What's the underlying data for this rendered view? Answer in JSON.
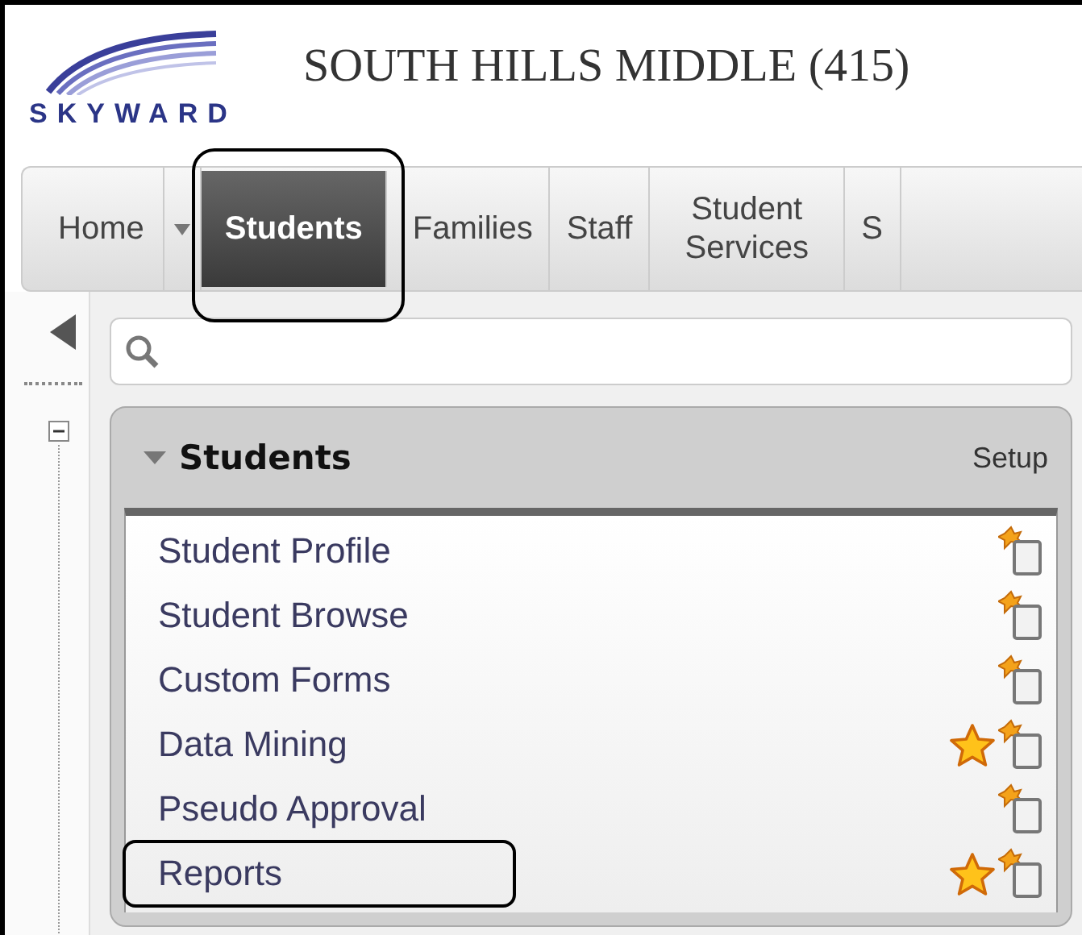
{
  "header": {
    "logo_text": "SKYWARD",
    "title": "SOUTH HILLS MIDDLE (415)"
  },
  "tabs": [
    {
      "label": "Home",
      "selected": false
    },
    {
      "label": "Students",
      "selected": true
    },
    {
      "label": "Families",
      "selected": false
    },
    {
      "label": "Staff",
      "selected": false
    },
    {
      "label": "Student Services",
      "selected": false
    },
    {
      "label": "S",
      "selected": false
    }
  ],
  "panel": {
    "title": "Students",
    "expanded": true,
    "setup": "Setup",
    "items": [
      {
        "label": "Student Profile",
        "favorite": false,
        "highlighted": false
      },
      {
        "label": "Student Browse",
        "favorite": false,
        "highlighted": false
      },
      {
        "label": "Custom Forms",
        "favorite": false,
        "highlighted": false
      },
      {
        "label": "Data Mining",
        "favorite": true,
        "highlighted": false
      },
      {
        "label": "Pseudo Approval",
        "favorite": false,
        "highlighted": false
      },
      {
        "label": "Reports",
        "favorite": true,
        "highlighted": true
      }
    ]
  }
}
